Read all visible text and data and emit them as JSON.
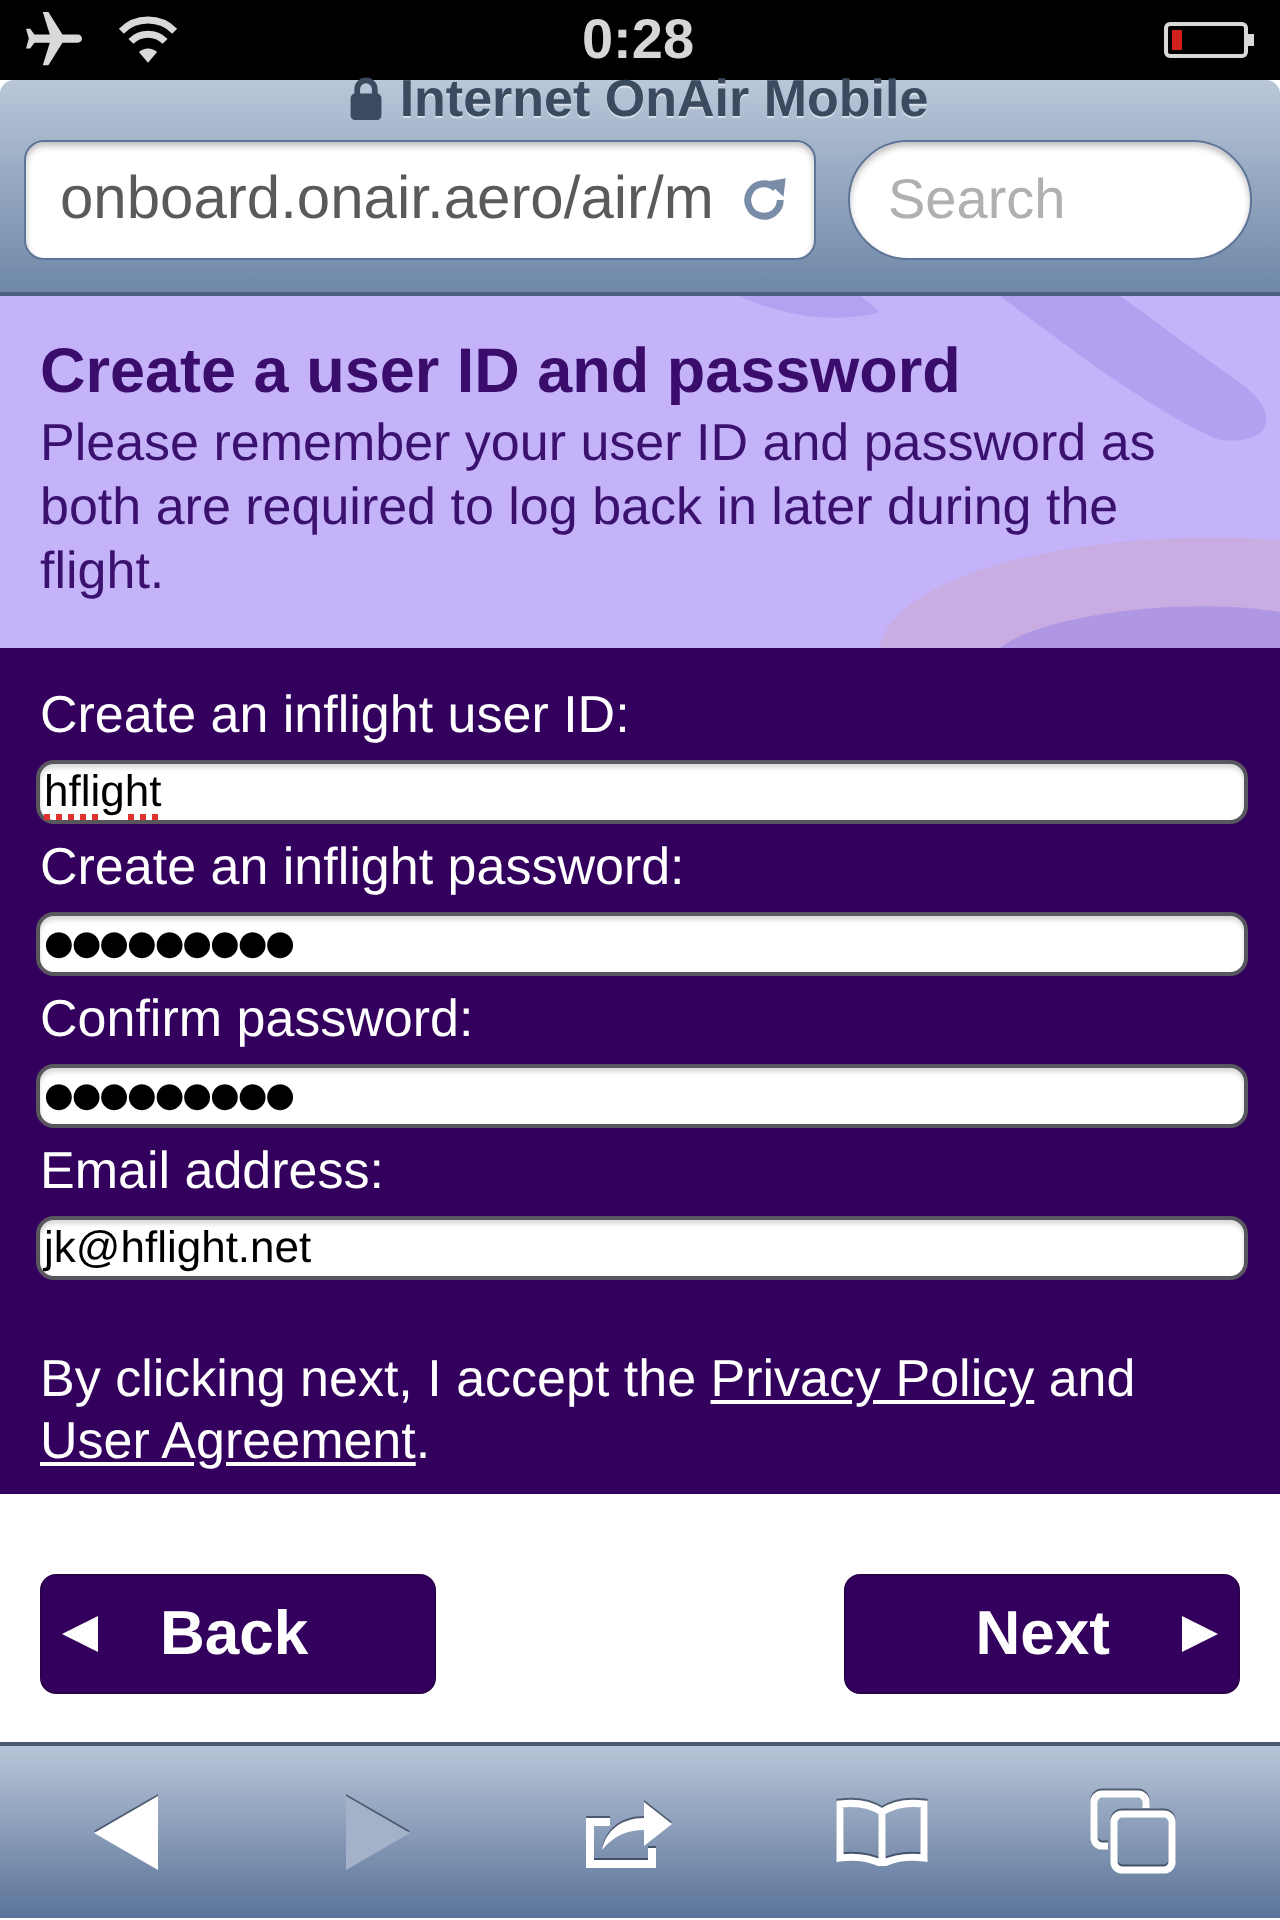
{
  "status_bar": {
    "time": "0:28"
  },
  "browser": {
    "page_title": "Internet OnAir Mobile",
    "secure": true,
    "address": "onboard.onair.aero/air/m",
    "search": {
      "placeholder": "Search"
    }
  },
  "header": {
    "title": "Create a user ID and password",
    "text": "Please remember your user ID and password as both are required to log back in later during the flight."
  },
  "form": {
    "fields": [
      {
        "label": "Create an inflight user ID:",
        "value": "hflight",
        "masked": false,
        "misspelled": true
      },
      {
        "label": "Create an inflight password:",
        "value": "●●●●●●●●●",
        "masked": true,
        "misspelled": false
      },
      {
        "label": "Confirm password:",
        "value": "●●●●●●●●●",
        "masked": true,
        "misspelled": false
      },
      {
        "label": "Email address:",
        "value": "jk@hflight.net",
        "masked": false,
        "misspelled": false
      }
    ],
    "consent": [
      {
        "kind": "text",
        "text": "By clicking next, I accept the "
      },
      {
        "kind": "link",
        "text": "Privacy Policy"
      },
      {
        "kind": "text",
        "text": " and "
      },
      {
        "kind": "link",
        "text": "User Agreement"
      },
      {
        "kind": "text",
        "text": "."
      }
    ]
  },
  "buttons": [
    {
      "label": "Back",
      "kind": "back"
    },
    {
      "label": "Next",
      "kind": "next"
    }
  ],
  "toolbar": [
    {
      "kind": "back",
      "disabled": false
    },
    {
      "kind": "forward",
      "disabled": true
    },
    {
      "kind": "share",
      "disabled": false
    },
    {
      "kind": "bookmarks",
      "disabled": false
    },
    {
      "kind": "tabs",
      "disabled": false
    }
  ]
}
